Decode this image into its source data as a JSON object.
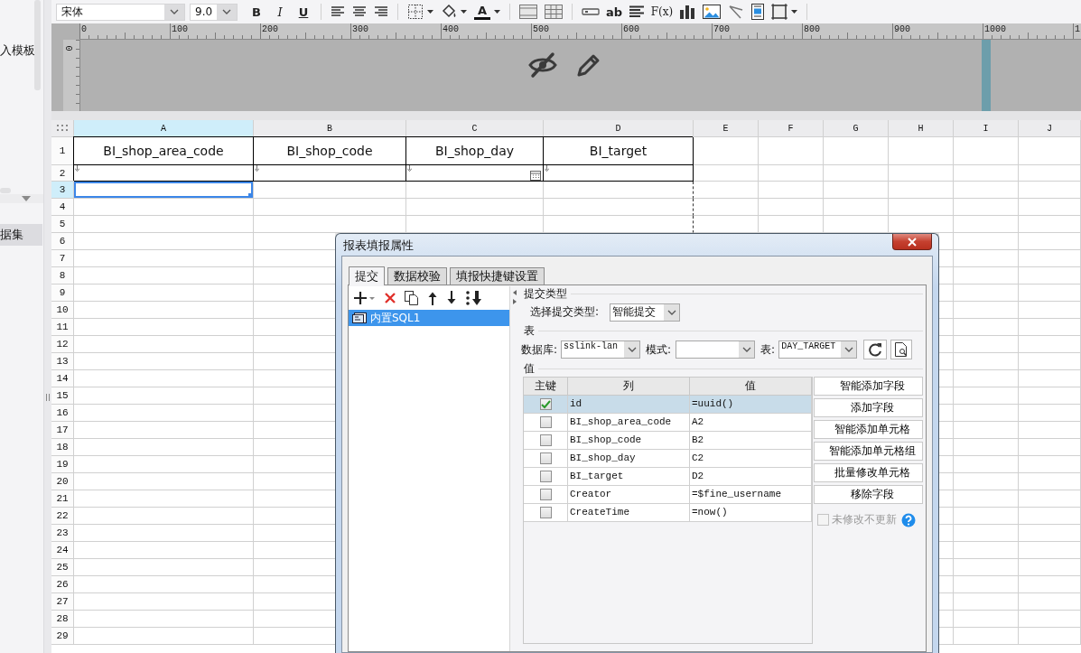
{
  "sidebar": {
    "items": [
      {
        "label": "入模板",
        "selected": false
      },
      {
        "label": "据集",
        "selected": true
      }
    ]
  },
  "toolbar": {
    "font": "宋体",
    "font_size": "9.0",
    "bold": "B",
    "italic": "I",
    "underline": "U",
    "font_color": "A",
    "text_tool": "ab",
    "formula": "F(x)"
  },
  "ruler": {
    "top_labels": [
      "0",
      "100",
      "200",
      "300",
      "400",
      "500",
      "600",
      "700",
      "800",
      "900",
      "1000",
      "1"
    ],
    "left_labels": [
      "0"
    ]
  },
  "sheet": {
    "columns": [
      {
        "label": "A",
        "selected": true
      },
      {
        "label": "B",
        "selected": false
      },
      {
        "label": "C",
        "selected": false
      },
      {
        "label": "D",
        "selected": false
      },
      {
        "label": "E",
        "selected": false
      },
      {
        "label": "F",
        "selected": false
      },
      {
        "label": "G",
        "selected": false
      },
      {
        "label": "H",
        "selected": false
      },
      {
        "label": "I",
        "selected": false
      },
      {
        "label": "J",
        "selected": false
      }
    ],
    "rows": [
      {
        "label": "1",
        "selected": false,
        "cells": [
          {
            "kind": "text",
            "text": "BI_shop_area_code"
          },
          {
            "kind": "text",
            "text": "BI_shop_code"
          },
          {
            "kind": "text",
            "text": "BI_shop_day"
          },
          {
            "kind": "text",
            "text": "BI_target"
          }
        ]
      },
      {
        "label": "2",
        "selected": false,
        "cells": [
          {
            "kind": "expand"
          },
          {
            "kind": "expand"
          },
          {
            "kind": "date"
          },
          {
            "kind": "expand"
          }
        ]
      },
      {
        "label": "3",
        "selected": true
      },
      {
        "label": "4",
        "selected": false
      },
      {
        "label": "5",
        "selected": false
      },
      {
        "label": "6",
        "selected": false
      },
      {
        "label": "7",
        "selected": false
      },
      {
        "label": "8",
        "selected": false
      },
      {
        "label": "9",
        "selected": false
      },
      {
        "label": "10",
        "selected": false
      },
      {
        "label": "11",
        "selected": false
      },
      {
        "label": "12",
        "selected": false
      },
      {
        "label": "13",
        "selected": false
      },
      {
        "label": "14",
        "selected": false
      },
      {
        "label": "15",
        "selected": false
      },
      {
        "label": "16",
        "selected": false
      },
      {
        "label": "17",
        "selected": false
      },
      {
        "label": "18",
        "selected": false
      },
      {
        "label": "19",
        "selected": false
      },
      {
        "label": "20",
        "selected": false
      },
      {
        "label": "21",
        "selected": false
      },
      {
        "label": "22",
        "selected": false
      },
      {
        "label": "23",
        "selected": false
      },
      {
        "label": "24",
        "selected": false
      },
      {
        "label": "25",
        "selected": false
      },
      {
        "label": "26",
        "selected": false
      },
      {
        "label": "27",
        "selected": false
      },
      {
        "label": "28",
        "selected": false
      },
      {
        "label": "29",
        "selected": false
      }
    ]
  },
  "dialog": {
    "title": "报表填报属性",
    "tabs": [
      {
        "label": "提交",
        "selected": true
      },
      {
        "label": "数据校验",
        "selected": false
      },
      {
        "label": "填报快捷键设置",
        "selected": false
      }
    ],
    "list_items": [
      {
        "label": "内置SQL1",
        "selected": true
      }
    ],
    "submit_type": {
      "heading": "提交类型",
      "label": "选择提交类型:",
      "value": "智能提交"
    },
    "table_section": {
      "heading": "表",
      "database_label": "数据库:",
      "database": "sslink-lan",
      "schema_label": "模式:",
      "table_label": "表:",
      "table": "DAY_TARGET"
    },
    "values": {
      "heading": "值",
      "columns": [
        "主键",
        "列",
        "值"
      ],
      "rows": [
        {
          "key": true,
          "selected": true,
          "column": "id",
          "value": "=uuid()"
        },
        {
          "key": false,
          "selected": false,
          "column": "BI_shop_area_code",
          "value": "A2"
        },
        {
          "key": false,
          "selected": false,
          "column": "BI_shop_code",
          "value": "B2"
        },
        {
          "key": false,
          "selected": false,
          "column": "BI_shop_day",
          "value": "C2"
        },
        {
          "key": false,
          "selected": false,
          "column": "BI_target",
          "value": "D2"
        },
        {
          "key": false,
          "selected": false,
          "column": "Creator",
          "value": "=$fine_username"
        },
        {
          "key": false,
          "selected": false,
          "column": "CreateTime",
          "value": "=now()"
        }
      ]
    },
    "buttons": [
      "智能添加字段",
      "添加字段",
      "智能添加单元格",
      "智能添加单元格组",
      "批量修改单元格",
      "移除字段"
    ],
    "no_update": {
      "label": "未修改不更新",
      "checked": false,
      "disabled": true
    }
  }
}
